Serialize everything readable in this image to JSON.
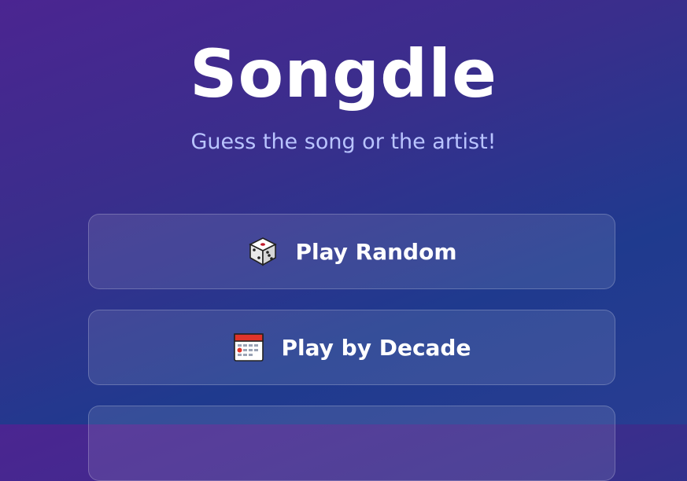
{
  "app": {
    "title": "Songdle",
    "subtitle": "Guess the song or the artist!"
  },
  "modes": [
    {
      "label": "Play Random",
      "icon": "dice-icon"
    },
    {
      "label": "Play by Decade",
      "icon": "calendar-icon"
    },
    {
      "label": "",
      "icon": ""
    }
  ],
  "colors": {
    "background_start": "#4b2591",
    "background_end": "#1f3a8e",
    "subtitle": "#b9c4ff",
    "button_fill": "rgba(255,255,255,0.10)"
  }
}
